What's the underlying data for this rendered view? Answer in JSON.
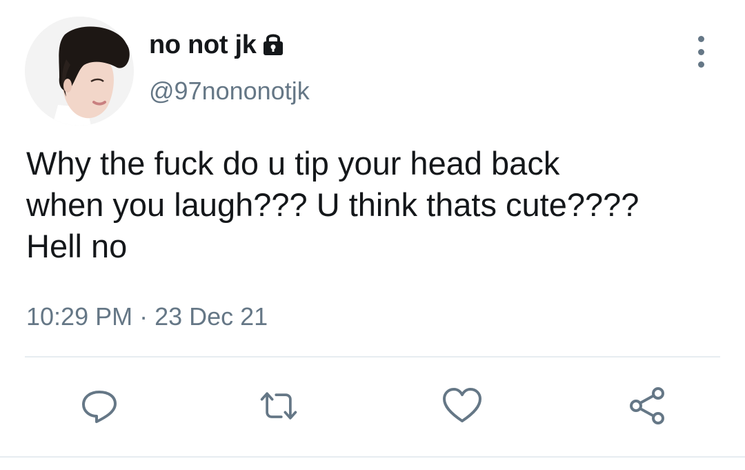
{
  "tweet": {
    "author": {
      "display_name": "no not jk",
      "handle": "@97nononotjk",
      "protected_icon": "lock-icon",
      "avatar": "avatar-photo"
    },
    "text_lines": [
      "Why the fuck do u tip your head back",
      "when you laugh??? U think thats cute????",
      "Hell no"
    ],
    "time": "10:29 PM",
    "separator": "·",
    "date": "23 Dec 21"
  },
  "actions": [
    {
      "name": "reply",
      "icon": "reply-icon"
    },
    {
      "name": "retweet",
      "icon": "retweet-icon"
    },
    {
      "name": "like",
      "icon": "heart-icon"
    },
    {
      "name": "share",
      "icon": "share-icon"
    }
  ],
  "more_menu": {
    "icon": "more-vertical-icon"
  },
  "colors": {
    "text_primary": "#14171a",
    "text_secondary": "#657786",
    "divider": "#e6ecf0"
  }
}
